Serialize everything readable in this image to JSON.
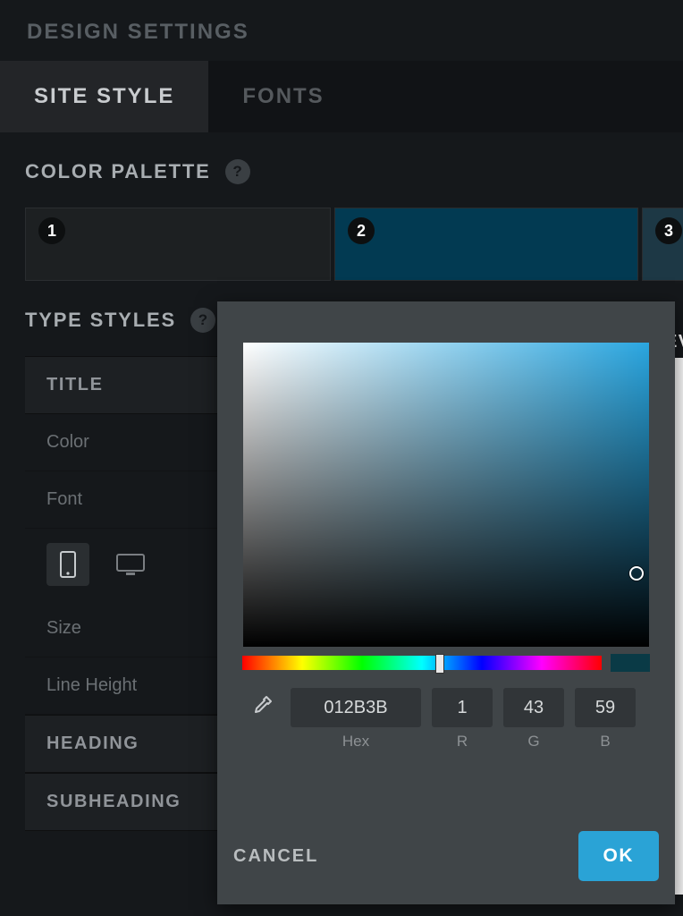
{
  "header": {
    "title": "DESIGN SETTINGS"
  },
  "tabs": [
    {
      "label": "SITE STYLE",
      "active": true
    },
    {
      "label": "FONTS",
      "active": false
    }
  ],
  "color_palette": {
    "title": "COLOR PALETTE",
    "swatches": [
      {
        "number": "1",
        "color": "#1d2022"
      },
      {
        "number": "2",
        "color": "#023a52"
      },
      {
        "number": "3",
        "color": "#1d3845"
      }
    ]
  },
  "preview_label": "REV",
  "type_styles": {
    "title": "TYPE STYLES",
    "groups": [
      {
        "name": "TITLE",
        "rows": [
          {
            "label": "Color"
          },
          {
            "label": "Font"
          },
          {
            "label": "Size"
          },
          {
            "label": "Line Height"
          }
        ]
      },
      {
        "name": "HEADING"
      },
      {
        "name": "SUBHEADING"
      }
    ]
  },
  "color_picker": {
    "hex": "012B3B",
    "r": "1",
    "g": "43",
    "b": "59",
    "labels": {
      "hex": "Hex",
      "r": "R",
      "g": "G",
      "b": "B"
    },
    "current_color": "#012B3B",
    "actions": {
      "cancel": "CANCEL",
      "ok": "OK"
    }
  }
}
